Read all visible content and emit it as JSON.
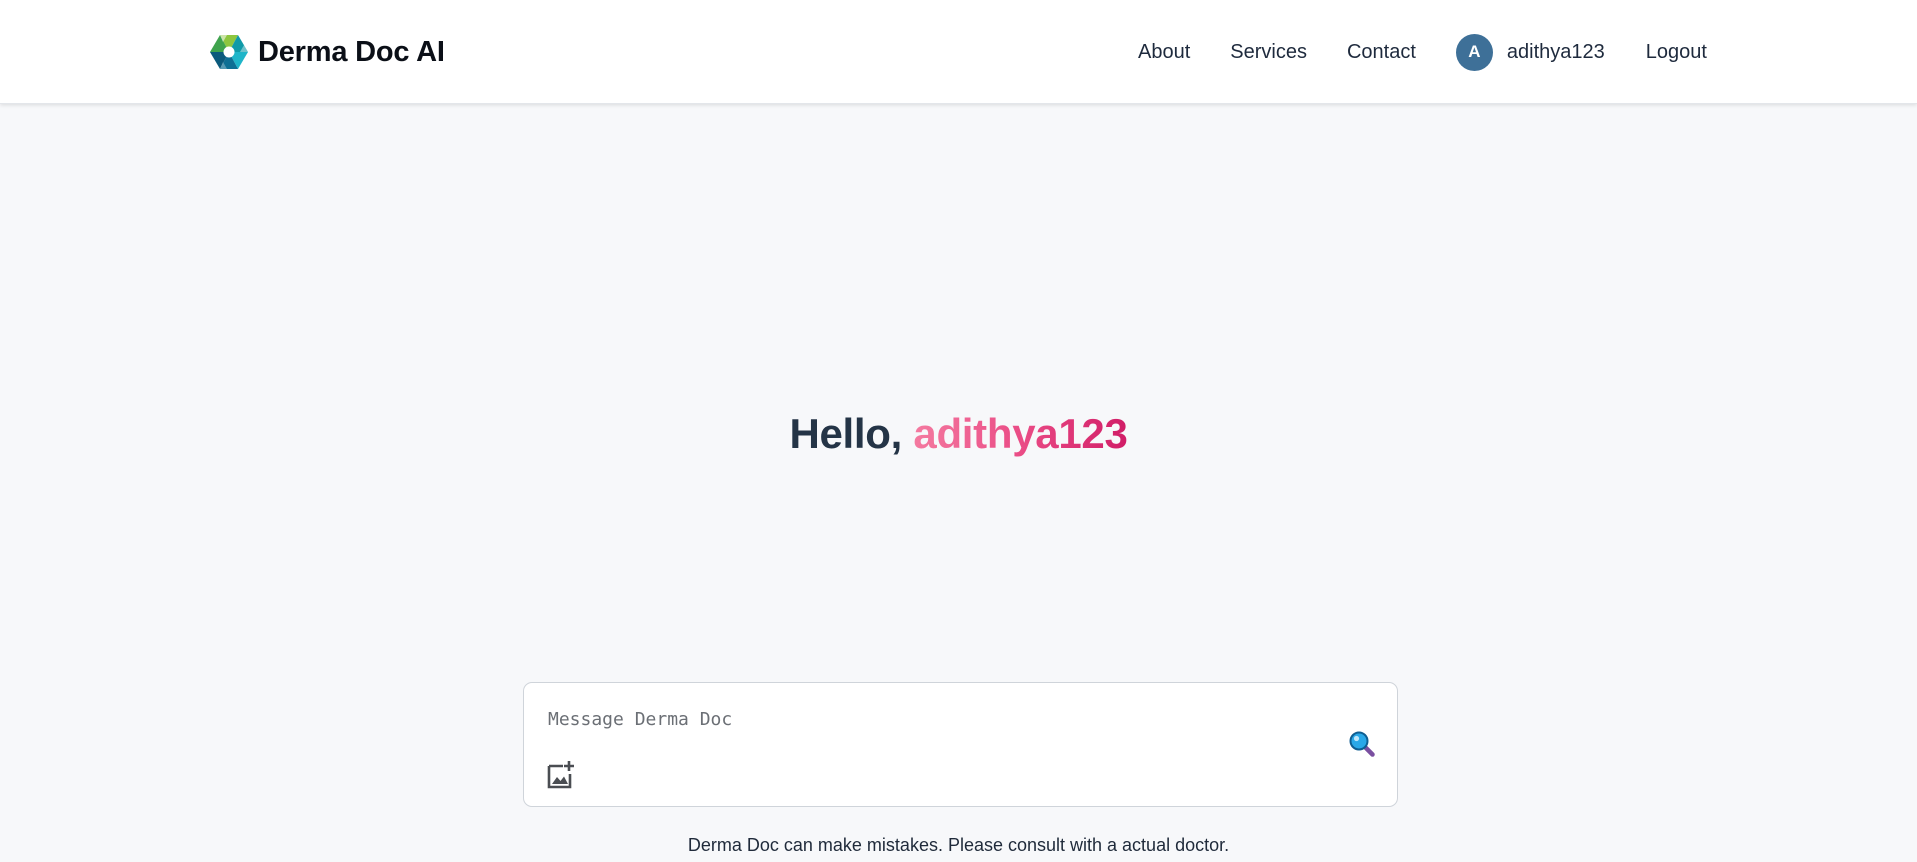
{
  "brand": {
    "name": "Derma Doc AI",
    "logo_icon": "aperture-logo-icon"
  },
  "nav": {
    "about": "About",
    "services": "Services",
    "contact": "Contact",
    "user": {
      "avatar_initial": "A",
      "username": "adithya123"
    },
    "logout": "Logout"
  },
  "greeting": {
    "prefix": "Hello, ",
    "name": "adithya123"
  },
  "composer": {
    "placeholder": "Message Derma Doc",
    "value": "",
    "image_icon": "add-image-icon",
    "send_icon": "magnifier-icon"
  },
  "disclaimer": "Derma Doc can make mistakes. Please consult with a actual doctor.",
  "colors": {
    "page_bg": "#f7f8fa",
    "navbar_bg": "#ffffff",
    "avatar_bg": "#3e7098",
    "greeting_text": "#243446",
    "greeting_gradient_start": "#f47aa0",
    "greeting_gradient_end": "#d11d67"
  }
}
